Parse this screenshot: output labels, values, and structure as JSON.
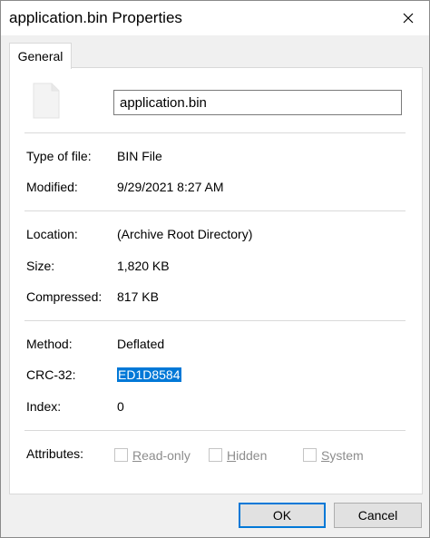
{
  "window": {
    "title": "application.bin Properties",
    "close_icon": "close-icon"
  },
  "tabs": [
    {
      "label": "General",
      "active": true
    }
  ],
  "file": {
    "icon": "file-icon",
    "name": "application.bin"
  },
  "properties": {
    "type_label": "Type of file:",
    "type_value": "BIN File",
    "modified_label": "Modified:",
    "modified_value": "9/29/2021 8:27 AM",
    "location_label": "Location:",
    "location_value": "(Archive Root Directory)",
    "size_label": "Size:",
    "size_value": "1,820 KB",
    "compressed_label": "Compressed:",
    "compressed_value": "817 KB",
    "method_label": "Method:",
    "method_value": "Deflated",
    "crc_label": "CRC-32:",
    "crc_value": "ED1D8584",
    "index_label": "Index:",
    "index_value": "0"
  },
  "attributes": {
    "label": "Attributes:",
    "items": [
      {
        "label_mnemonic": "R",
        "label_rest": "ead-only",
        "checked": false,
        "enabled": false
      },
      {
        "label_mnemonic": "H",
        "label_rest": "idden",
        "checked": false,
        "enabled": false
      },
      {
        "label_mnemonic": "S",
        "label_rest": "ystem",
        "checked": false,
        "enabled": false
      }
    ]
  },
  "buttons": {
    "ok_label": "OK",
    "cancel_label": "Cancel"
  },
  "colors": {
    "selection": "#0078d7",
    "disabled_text": "#8d8d8d"
  }
}
